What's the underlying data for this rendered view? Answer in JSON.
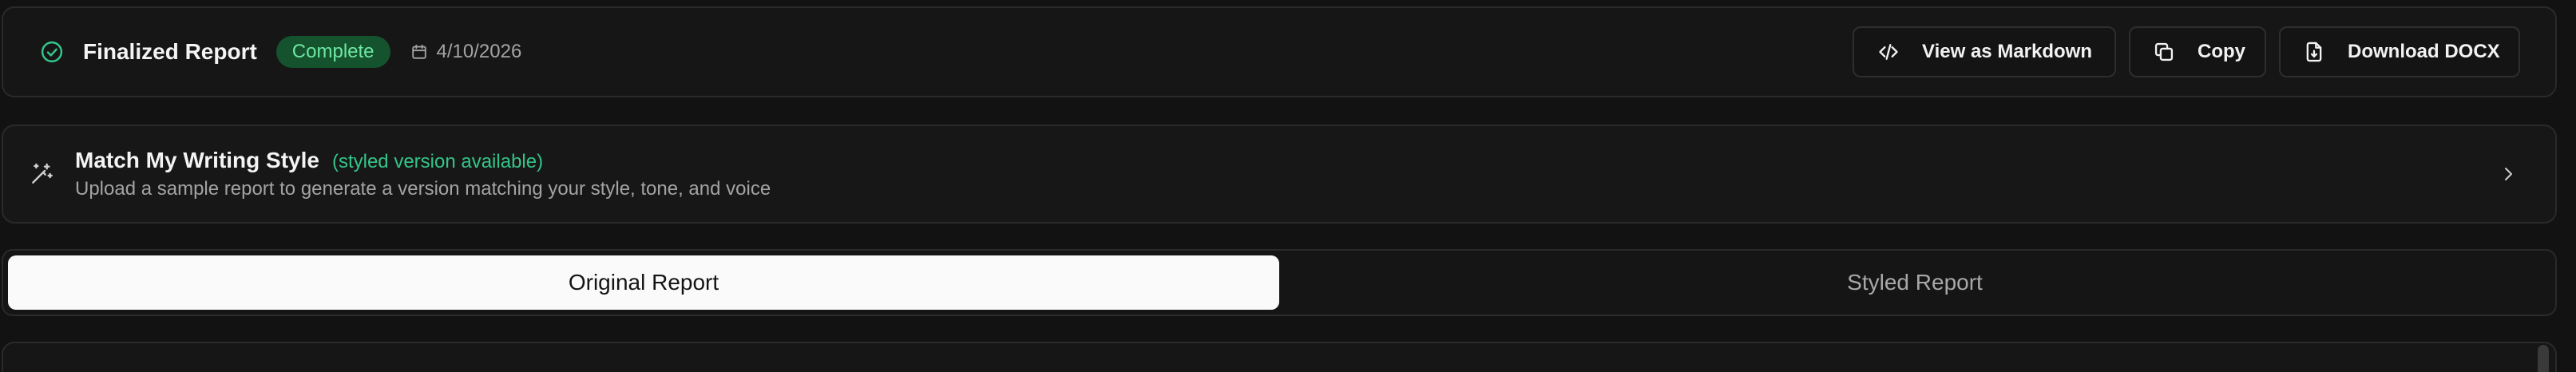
{
  "header": {
    "title": "Finalized Report",
    "status": "Complete",
    "date": "4/10/2026",
    "icons": {
      "status": "circle-check-icon",
      "date": "calendar-icon"
    },
    "actions": [
      {
        "label": "View as Markdown",
        "icon": "code-icon"
      },
      {
        "label": "Copy",
        "icon": "copy-icon"
      },
      {
        "label": "Download DOCX",
        "icon": "file-download-icon"
      }
    ]
  },
  "style_card": {
    "title": "Match My Writing Style",
    "available_note": "(styled version available)",
    "description": "Upload a sample report to generate a version matching your style, tone, and voice",
    "icon": "magic-wand-icon",
    "chevron": "chevron-right-icon"
  },
  "tabs": [
    {
      "label": "Original Report",
      "active": true
    },
    {
      "label": "Styled Report",
      "active": false
    }
  ],
  "colors": {
    "background": "#121212",
    "surface": "#161616",
    "border": "#2a2a2a",
    "accent_green": "#34c48a",
    "badge_bg": "#14532d",
    "badge_text": "#6ee7a3",
    "tab_active_bg": "#fafafa"
  }
}
